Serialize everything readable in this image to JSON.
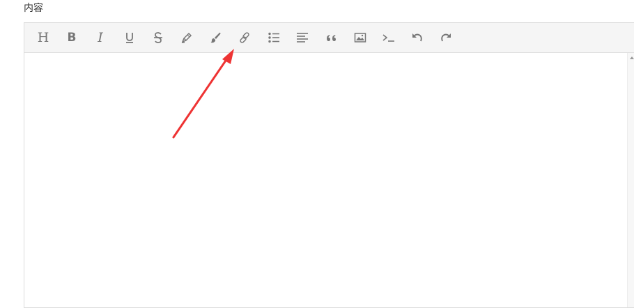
{
  "field": {
    "label": "内容"
  },
  "toolbar": {
    "buttons": [
      {
        "name": "heading-icon",
        "glyph": "H"
      },
      {
        "name": "bold-icon",
        "glyph": "B"
      },
      {
        "name": "italic-icon",
        "glyph": "I"
      },
      {
        "name": "underline-icon"
      },
      {
        "name": "strikethrough-icon"
      },
      {
        "name": "highlighter-icon"
      },
      {
        "name": "paint-brush-icon"
      },
      {
        "name": "link-icon"
      },
      {
        "name": "bullet-list-icon"
      },
      {
        "name": "align-left-icon"
      },
      {
        "name": "quote-icon"
      },
      {
        "name": "image-icon"
      },
      {
        "name": "code-icon"
      },
      {
        "name": "undo-icon"
      },
      {
        "name": "redo-icon"
      }
    ]
  },
  "colors": {
    "toolbar_bg": "#f5f5f5",
    "icon": "#777777",
    "annotation_arrow": "#ee3333"
  }
}
